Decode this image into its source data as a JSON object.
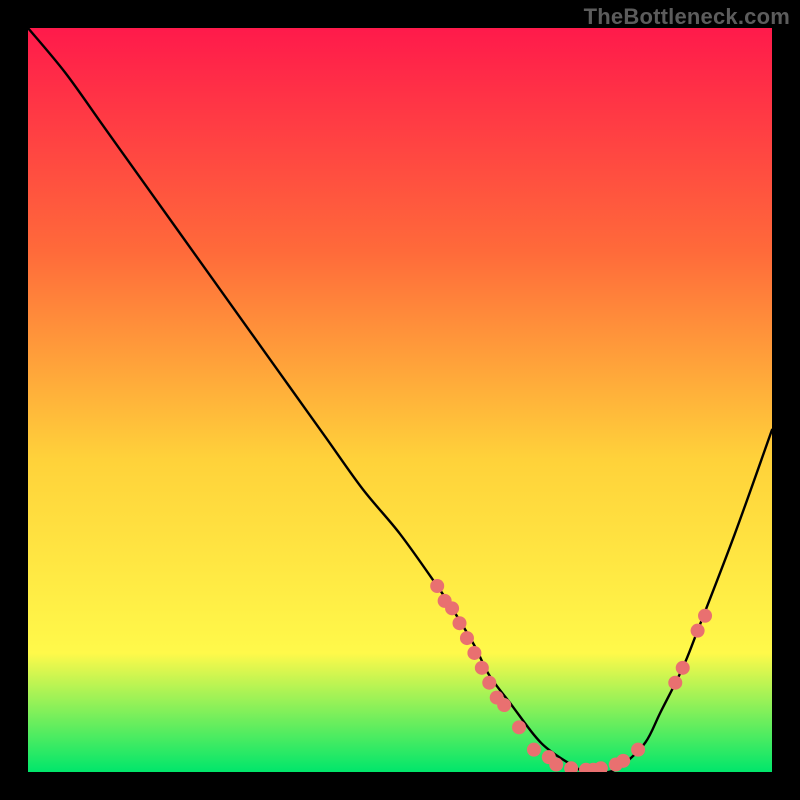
{
  "watermark": "TheBottleneck.com",
  "colors": {
    "gradient_top": "#ff1a4b",
    "gradient_mid_upper": "#ff6a3a",
    "gradient_mid": "#ffd23a",
    "gradient_mid_lower": "#fff94a",
    "gradient_bottom": "#00e66b",
    "curve": "#000000",
    "dots": "#e97070",
    "background": "#000000"
  },
  "chart_data": {
    "type": "line",
    "title": "",
    "xlabel": "",
    "ylabel": "",
    "xlim": [
      0,
      100
    ],
    "ylim": [
      0,
      100
    ],
    "grid": false,
    "legend": false,
    "series": [
      {
        "name": "bottleneck-curve",
        "x": [
          0,
          5,
          10,
          15,
          20,
          25,
          30,
          35,
          40,
          45,
          50,
          55,
          57,
          60,
          62,
          65,
          68,
          70,
          73,
          75,
          78,
          80,
          83,
          85,
          88,
          90,
          95,
          100
        ],
        "y": [
          100,
          94,
          87,
          80,
          73,
          66,
          59,
          52,
          45,
          38,
          32,
          25,
          22,
          17,
          13,
          9,
          5,
          3,
          1,
          0,
          0,
          1,
          4,
          8,
          14,
          19,
          32,
          46
        ]
      }
    ],
    "scatter_points": {
      "name": "highlighted-points",
      "points": [
        {
          "x": 55,
          "y": 25
        },
        {
          "x": 56,
          "y": 23
        },
        {
          "x": 57,
          "y": 22
        },
        {
          "x": 58,
          "y": 20
        },
        {
          "x": 59,
          "y": 18
        },
        {
          "x": 60,
          "y": 16
        },
        {
          "x": 61,
          "y": 14
        },
        {
          "x": 62,
          "y": 12
        },
        {
          "x": 63,
          "y": 10
        },
        {
          "x": 64,
          "y": 9
        },
        {
          "x": 66,
          "y": 6
        },
        {
          "x": 68,
          "y": 3
        },
        {
          "x": 70,
          "y": 2
        },
        {
          "x": 71,
          "y": 1
        },
        {
          "x": 73,
          "y": 0.5
        },
        {
          "x": 75,
          "y": 0.3
        },
        {
          "x": 76,
          "y": 0.3
        },
        {
          "x": 77,
          "y": 0.5
        },
        {
          "x": 79,
          "y": 1
        },
        {
          "x": 80,
          "y": 1.5
        },
        {
          "x": 82,
          "y": 3
        },
        {
          "x": 87,
          "y": 12
        },
        {
          "x": 88,
          "y": 14
        },
        {
          "x": 90,
          "y": 19
        },
        {
          "x": 91,
          "y": 21
        }
      ]
    }
  }
}
